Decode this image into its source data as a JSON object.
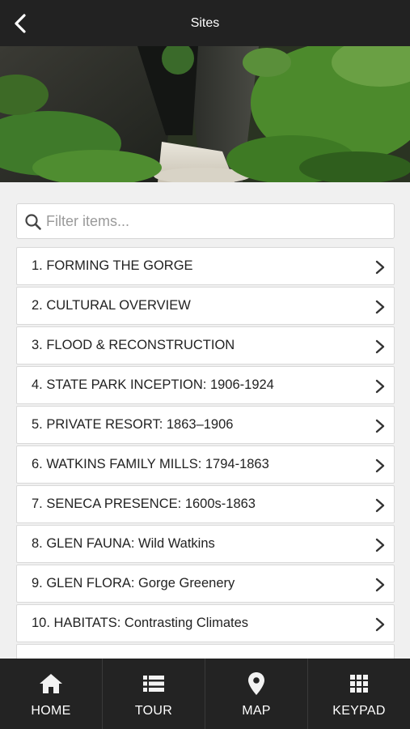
{
  "header": {
    "title": "Sites"
  },
  "search": {
    "placeholder": "Filter items..."
  },
  "items": [
    {
      "label": "1. FORMING THE GORGE"
    },
    {
      "label": "2. CULTURAL OVERVIEW"
    },
    {
      "label": "3. FLOOD & RECONSTRUCTION"
    },
    {
      "label": "4. STATE PARK INCEPTION: 1906-1924"
    },
    {
      "label": "5. PRIVATE RESORT: 1863–1906"
    },
    {
      "label": "6. WATKINS FAMILY MILLS: 1794-1863"
    },
    {
      "label": "7. SENECA PRESENCE: 1600s-1863"
    },
    {
      "label": "8. GLEN FAUNA: Wild Watkins"
    },
    {
      "label": "9. GLEN FLORA: Gorge Greenery"
    },
    {
      "label": "10. HABITATS: Contrasting Climates"
    },
    {
      "label": ""
    }
  ],
  "tabs": [
    {
      "label": "HOME",
      "icon": "home-icon"
    },
    {
      "label": "TOUR",
      "icon": "list-icon"
    },
    {
      "label": "MAP",
      "icon": "map-pin-icon"
    },
    {
      "label": "KEYPAD",
      "icon": "keypad-icon"
    }
  ],
  "colors": {
    "topbar": "#222222",
    "tabbar": "#232323",
    "background": "#f0f0f0"
  }
}
